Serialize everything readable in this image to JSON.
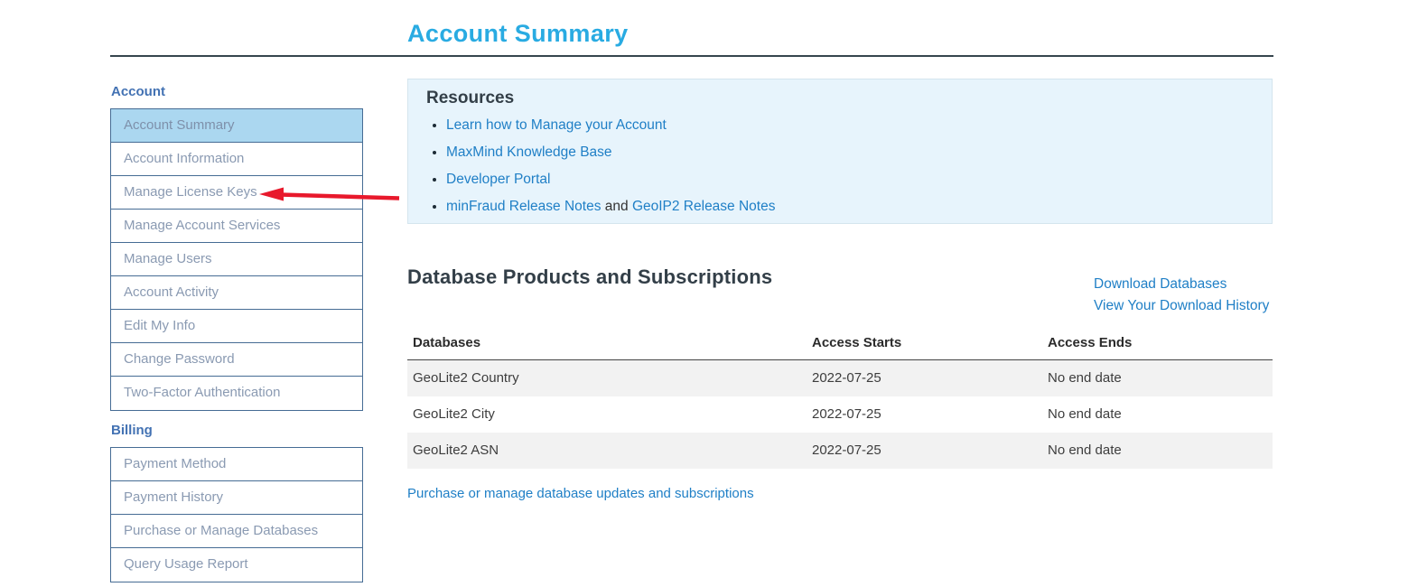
{
  "page": {
    "title": "Account Summary"
  },
  "sidebar": {
    "sections": [
      {
        "heading": "Account",
        "items": [
          {
            "label": "Account Summary",
            "active": true
          },
          {
            "label": "Account Information"
          },
          {
            "label": "Manage License Keys"
          },
          {
            "label": "Manage Account Services"
          },
          {
            "label": "Manage Users"
          },
          {
            "label": "Account Activity"
          },
          {
            "label": "Edit My Info"
          },
          {
            "label": "Change Password"
          },
          {
            "label": "Two-Factor Authentication"
          }
        ]
      },
      {
        "heading": "Billing",
        "items": [
          {
            "label": "Payment Method"
          },
          {
            "label": "Payment History"
          },
          {
            "label": "Purchase or Manage Databases"
          },
          {
            "label": "Query Usage Report"
          }
        ]
      }
    ]
  },
  "resources": {
    "heading": "Resources",
    "items": [
      {
        "link": "Learn how to Manage your Account"
      },
      {
        "link": "MaxMind Knowledge Base"
      },
      {
        "link": "Developer Portal"
      },
      {
        "link": "minFraud Release Notes",
        "separator": " and ",
        "link2": "GeoIP2 Release Notes"
      }
    ]
  },
  "databases": {
    "heading": "Database Products and Subscriptions",
    "actions": [
      "Download Databases",
      "View Your Download History"
    ],
    "table": {
      "headers": [
        "Databases",
        "Access Starts",
        "Access Ends"
      ],
      "rows": [
        [
          "GeoLite2 Country",
          "2022-07-25",
          "No end date"
        ],
        [
          "GeoLite2 City",
          "2022-07-25",
          "No end date"
        ],
        [
          "GeoLite2 ASN",
          "2022-07-25",
          "No end date"
        ]
      ]
    },
    "footer_link": "Purchase or manage database updates and subscriptions"
  },
  "colors": {
    "title_blue": "#29abe2",
    "link_blue": "#1f7fc6",
    "sidebar_heading_blue": "#4372b3",
    "sidebar_border": "#466c94",
    "sidebar_text": "#8a9ab2",
    "active_item_bg": "#abd7f0",
    "heading_dark": "#333f48",
    "resources_bg": "#e7f4fc",
    "resources_border": "#d4e5ee",
    "table_alt_row_bg": "#f2f2f2",
    "divider_dark": "#36454e",
    "arrow_red": "#e8192c"
  }
}
